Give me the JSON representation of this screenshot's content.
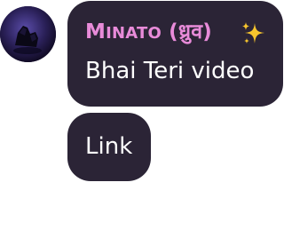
{
  "chat": {
    "author": {
      "name_initial": "M",
      "name_rest": "INATO",
      "name_suffix": " (ध्रुव)",
      "name_color": "#e88bd9",
      "avatar": "avatar-image",
      "badge_icon": "sparkles-icon"
    },
    "messages": [
      {
        "text": "Bhai Teri video"
      },
      {
        "text": "Link"
      }
    ],
    "bubble_color": "#2b2436",
    "text_color": "#ffffff"
  }
}
